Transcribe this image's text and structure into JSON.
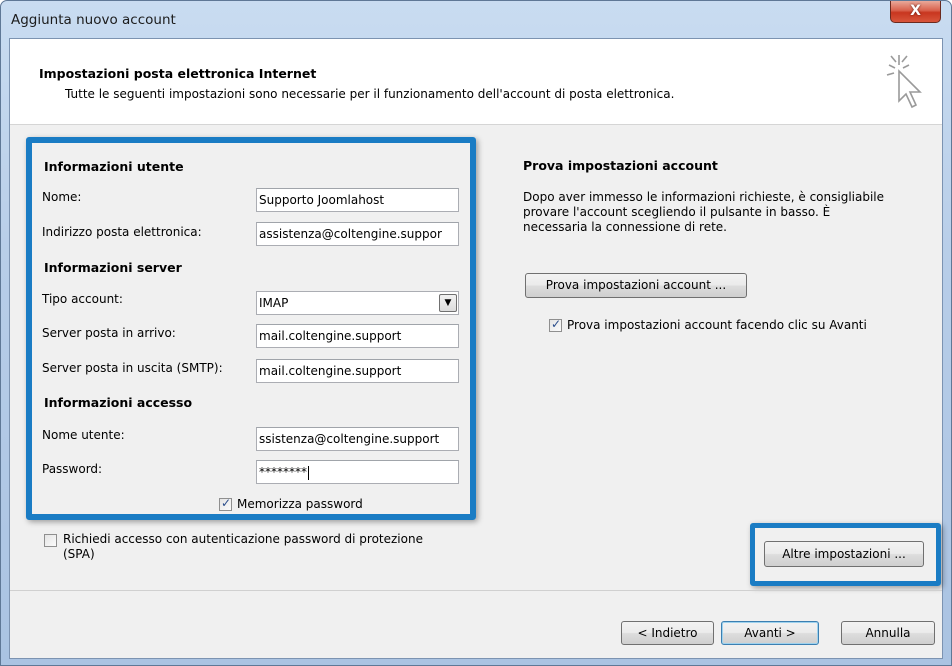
{
  "window": {
    "title": "Aggiunta nuovo account",
    "close_label": "X"
  },
  "header": {
    "title": "Impostazioni posta elettronica Internet",
    "subtitle": "Tutte le seguenti impostazioni sono necessarie per il funzionamento dell'account di posta elettronica."
  },
  "user_info": {
    "section": "Informazioni utente",
    "name_label": "Nome:",
    "name_value": "Supporto Joomlahost",
    "email_label": "Indirizzo posta elettronica:",
    "email_value": "assistenza@coltengine.suppor"
  },
  "server_info": {
    "section": "Informazioni server",
    "account_type_label": "Tipo account:",
    "account_type_value": "IMAP",
    "incoming_label": "Server posta in arrivo:",
    "incoming_value": "mail.coltengine.support",
    "outgoing_label": "Server posta in uscita (SMTP):",
    "outgoing_value": "mail.coltengine.support"
  },
  "login_info": {
    "section": "Informazioni accesso",
    "username_label": "Nome utente:",
    "username_value": "ssistenza@coltengine.support",
    "password_label": "Password:",
    "password_value": "********",
    "remember_label": "Memorizza password",
    "remember_checked": true
  },
  "spa": {
    "label_line1": "Richiedi accesso con autenticazione password di protezione",
    "label_line2": "(SPA)",
    "checked": false
  },
  "test": {
    "section": "Prova impostazioni account",
    "description_line1": "Dopo aver immesso le informazioni richieste, è consigliabile",
    "description_line2": "provare l'account scegliendo il pulsante in basso. È",
    "description_line3": "necessaria la connessione di rete.",
    "button_label": "Prova impostazioni account ...",
    "auto_test_label": "Prova impostazioni account facendo clic su Avanti",
    "auto_test_checked": true
  },
  "more_settings_label": "Altre impostazioni ...",
  "footer": {
    "back_label": "< Indietro",
    "next_label": "Avanti >",
    "cancel_label": "Annulla"
  },
  "colors": {
    "highlight": "#1a7cc4",
    "close_button": "#d0442c"
  }
}
